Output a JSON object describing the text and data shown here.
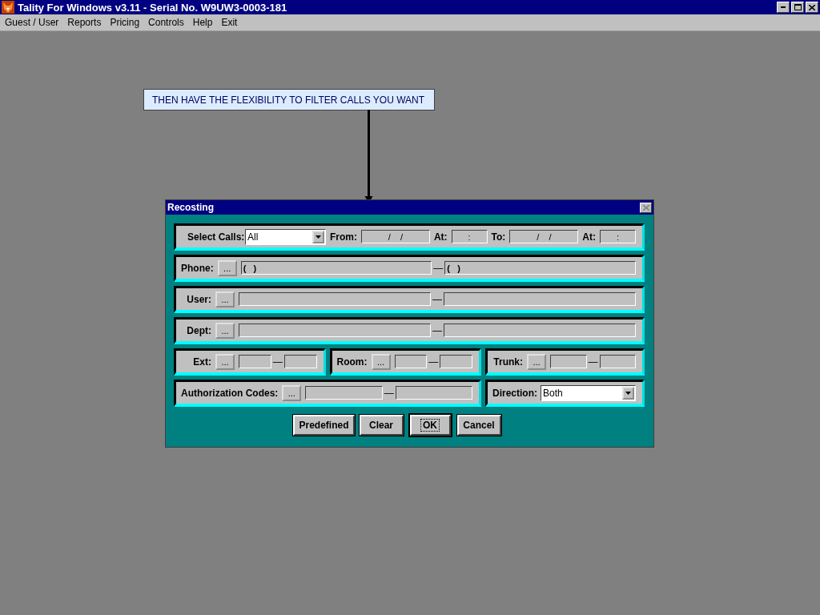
{
  "window": {
    "title": "Tality For Windows v3.11 - Serial No. W9UW3-0003-181"
  },
  "menu": [
    {
      "label": "Guest / User"
    },
    {
      "label": "Reports"
    },
    {
      "label": "Pricing"
    },
    {
      "label": "Controls"
    },
    {
      "label": "Help"
    },
    {
      "label": "Exit"
    }
  ],
  "callout": {
    "text": "THEN HAVE THE FLEXIBILITY TO FILTER CALLS YOU WANT"
  },
  "dialog": {
    "title": "Recosting",
    "rows": [
      {
        "panels": [
          {
            "items": [
              {
                "kind": "label",
                "text": "Select Calls:"
              },
              {
                "kind": "dropdown",
                "value": "All"
              },
              {
                "kind": "label",
                "text": "From:"
              },
              {
                "kind": "date-field",
                "value": "/    /"
              },
              {
                "kind": "label",
                "text": "At:"
              },
              {
                "kind": "time-field",
                "value": ":"
              },
              {
                "kind": "label",
                "text": "To:"
              },
              {
                "kind": "date-field",
                "value": "/    /"
              },
              {
                "kind": "label",
                "text": "At:"
              },
              {
                "kind": "time-field",
                "value": ":"
              }
            ]
          }
        ]
      },
      {
        "panels": [
          {
            "items": [
              {
                "kind": "label",
                "text": "Phone:"
              },
              {
                "kind": "browse",
                "text": "..."
              },
              {
                "kind": "phone-field",
                "value": "(   )"
              },
              {
                "kind": "dash",
                "text": "—"
              },
              {
                "kind": "phone-field",
                "value": "(   )"
              }
            ]
          }
        ]
      },
      {
        "panels": [
          {
            "items": [
              {
                "kind": "label",
                "text": "User:"
              },
              {
                "kind": "browse",
                "text": "..."
              },
              {
                "kind": "field"
              },
              {
                "kind": "dash",
                "text": "—"
              },
              {
                "kind": "field"
              }
            ]
          }
        ]
      },
      {
        "panels": [
          {
            "items": [
              {
                "kind": "label",
                "text": "Dept:"
              },
              {
                "kind": "browse",
                "text": "..."
              },
              {
                "kind": "field"
              },
              {
                "kind": "dash",
                "text": "—"
              },
              {
                "kind": "field"
              }
            ]
          }
        ]
      },
      {
        "panels": [
          {
            "items": [
              {
                "kind": "label",
                "text": "Ext:"
              },
              {
                "kind": "browse",
                "text": "..."
              },
              {
                "kind": "field"
              },
              {
                "kind": "dash",
                "text": "—"
              },
              {
                "kind": "field"
              }
            ]
          },
          {
            "items": [
              {
                "kind": "label",
                "text": "Room:"
              },
              {
                "kind": "browse",
                "text": "..."
              },
              {
                "kind": "field"
              },
              {
                "kind": "dash",
                "text": "—"
              },
              {
                "kind": "field"
              }
            ]
          },
          {
            "items": [
              {
                "kind": "label",
                "text": "Trunk:"
              },
              {
                "kind": "browse",
                "text": "..."
              },
              {
                "kind": "field"
              },
              {
                "kind": "dash",
                "text": "—"
              },
              {
                "kind": "field"
              }
            ]
          }
        ]
      },
      {
        "panels": [
          {
            "items": [
              {
                "kind": "label",
                "text": "Authorization Codes:"
              },
              {
                "kind": "browse",
                "text": "..."
              },
              {
                "kind": "field"
              },
              {
                "kind": "dash",
                "text": "—"
              },
              {
                "kind": "field"
              }
            ]
          },
          {
            "items": [
              {
                "kind": "label",
                "text": "Direction:"
              },
              {
                "kind": "dropdown",
                "value": "Both"
              }
            ]
          }
        ]
      }
    ],
    "buttons": [
      {
        "label": "Predefined",
        "default": false
      },
      {
        "label": "Clear",
        "default": false
      },
      {
        "label": "OK",
        "default": true
      },
      {
        "label": "Cancel",
        "default": false
      }
    ]
  }
}
